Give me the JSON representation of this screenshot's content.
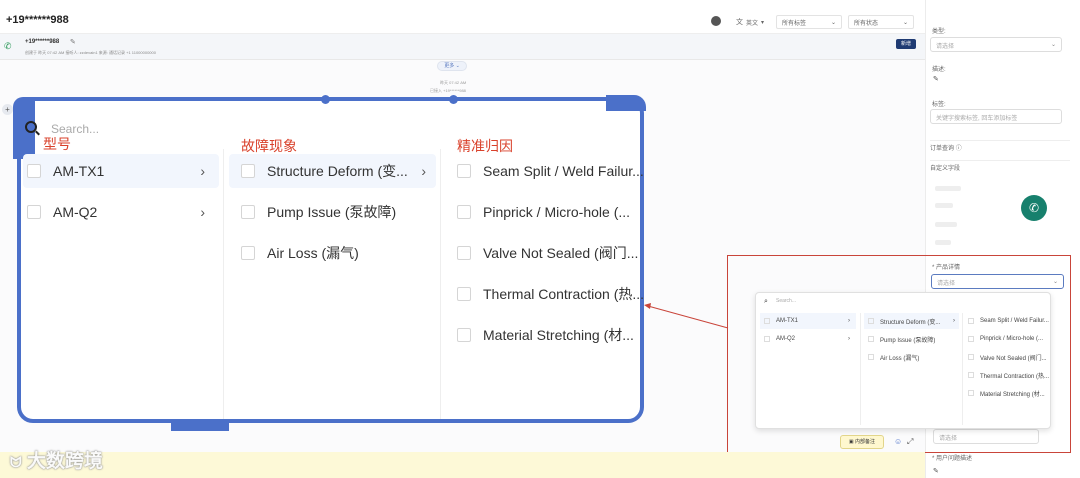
{
  "header": {
    "title": "+19******988",
    "language": "英文",
    "filter_tags": "所有标签",
    "filter_status": "所有状态"
  },
  "call": {
    "number": "+19******988",
    "meta": "创建于 昨天 07:42 AM   接听人: zzdevain1   来源: 通话记录 +1 11000000000",
    "badge": "新增",
    "more": "更多",
    "time_info": "昨天 07:42 AM",
    "call_info": "已接入 +19******988"
  },
  "zoom": {
    "search_placeholder": "Search...",
    "col_labels": [
      "型号",
      "故障现象",
      "精准归因"
    ],
    "models": [
      "AM-TX1",
      "AM-Q2"
    ],
    "symptoms": [
      "Structure Deform (变...",
      "Pump Issue (泵故障)",
      "Air Loss (漏气)"
    ],
    "causes": [
      "Seam Split / Weld Failur...",
      "Pinprick / Micro-hole (...",
      "Valve Not Sealed (阀门...",
      "Thermal Contraction (热...",
      "Material Stretching (材..."
    ]
  },
  "small_dropdown": {
    "search_placeholder": "Search...",
    "models": [
      "AM-TX1",
      "AM-Q2"
    ],
    "symptoms": [
      "Structure Deform (变...",
      "Pump Issue (泵故障)",
      "Air Loss (漏气)"
    ],
    "causes": [
      "Seam Split / Weld Failur...",
      "Pinprick / Micro-hole (...",
      "Valve Not Sealed (阀门...",
      "Thermal Contraction (热...",
      "Material Stretching (材..."
    ]
  },
  "right_panel": {
    "type_label": "类型:",
    "type_placeholder": "请选择",
    "desc_label": "描述:",
    "tag_label": "标签:",
    "tag_placeholder": "关键字搜索标签, 回车添加标签",
    "order_query": "订单查询",
    "custom_fields": "自定义字段",
    "product_detail": "* 产品详情",
    "product_placeholder": "请选择",
    "bottom_select": "请选择",
    "customer_desc": "* 用户问题描述"
  },
  "footer": {
    "watermark": "大数跨境",
    "internal_note": "内部备注"
  },
  "colors": {
    "frame_blue": "#4b70c9",
    "label_red": "#d9412b",
    "call_green": "#17806d",
    "highlight_box": "#c9453a"
  }
}
